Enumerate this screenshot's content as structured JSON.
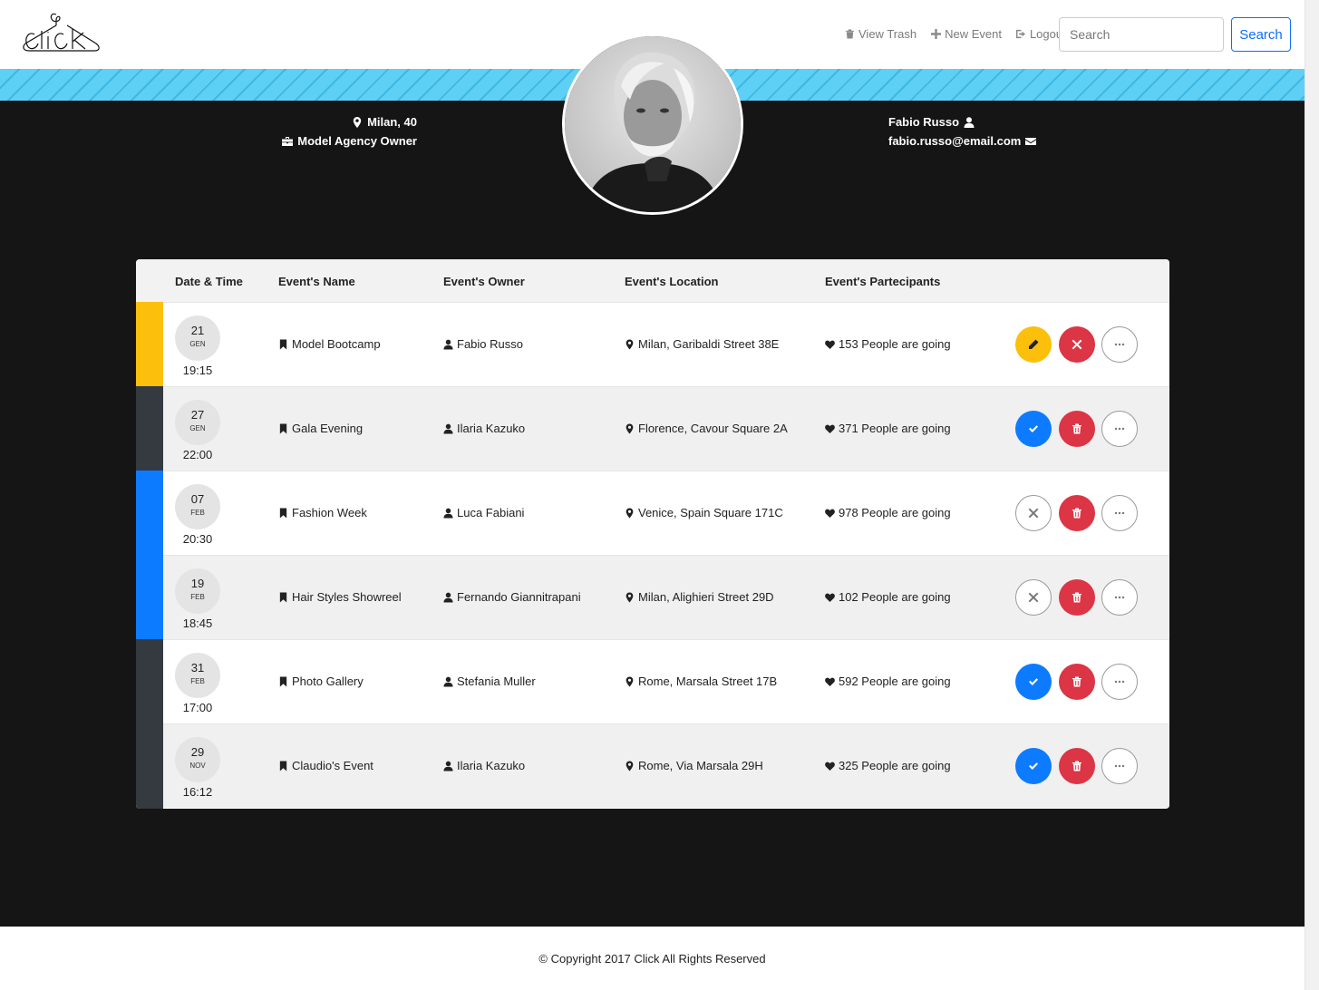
{
  "nav": {
    "logo_text": "Click",
    "view_trash": "View Trash",
    "new_event": "New Event",
    "logout": "Logout",
    "search_placeholder": "Search",
    "search_button": "Search"
  },
  "profile": {
    "location": "Milan, 40",
    "job": "Model Agency Owner",
    "name": "Fabio Russo",
    "email": "fabio.russo@email.com"
  },
  "table": {
    "headers": {
      "date": "Date & Time",
      "name": "Event's Name",
      "owner": "Event's Owner",
      "location": "Event's Location",
      "participants": "Event's Partecipants"
    },
    "rows": [
      {
        "day": "21",
        "month": "GEN",
        "time": "19:15",
        "name": "Model Bootcamp",
        "owner": "Fabio Russo",
        "location": "Milan, Garibaldi Street 38E",
        "participants": "153 People are going",
        "accent": "#fbbf0c",
        "status": "owned",
        "alt": false
      },
      {
        "day": "27",
        "month": "GEN",
        "time": "22:00",
        "name": "Gala Evening",
        "owner": "Ilaria Kazuko",
        "location": "Florence, Cavour Square 2A",
        "participants": "371 People are going",
        "accent": "#343a40",
        "status": "joined",
        "alt": true
      },
      {
        "day": "07",
        "month": "FEB",
        "time": "20:30",
        "name": "Fashion Week",
        "owner": "Luca Fabiani",
        "location": "Venice, Spain Square 171C",
        "participants": "978 People are going",
        "accent": "#0d7bff",
        "status": "not-joined",
        "alt": false
      },
      {
        "day": "19",
        "month": "FEB",
        "time": "18:45",
        "name": "Hair Styles Showreel",
        "owner": "Fernando Giannitrapani",
        "location": "Milan, Alighieri Street 29D",
        "participants": "102 People are going",
        "accent": "#0d7bff",
        "status": "not-joined",
        "alt": true
      },
      {
        "day": "31",
        "month": "FEB",
        "time": "17:00",
        "name": "Photo Gallery",
        "owner": "Stefania Muller",
        "location": "Rome, Marsala Street 17B",
        "participants": "592 People are going",
        "accent": "#343a40",
        "status": "joined",
        "alt": false
      },
      {
        "day": "29",
        "month": "NOV",
        "time": "16:12",
        "name": "Claudio's Event",
        "owner": "Ilaria Kazuko",
        "location": "Rome, Via Marsala 29H",
        "participants": "325 People are going",
        "accent": "#343a40",
        "status": "joined",
        "alt": true
      }
    ]
  },
  "footer": {
    "copyright": "© Copyright 2017 Click All Rights Reserved"
  },
  "colors": {
    "stripe": "#5fd0f5",
    "background": "#151515",
    "yellow": "#fbbf0c",
    "red": "#dc3545",
    "blue": "#0d7bff",
    "dark": "#343a40"
  }
}
